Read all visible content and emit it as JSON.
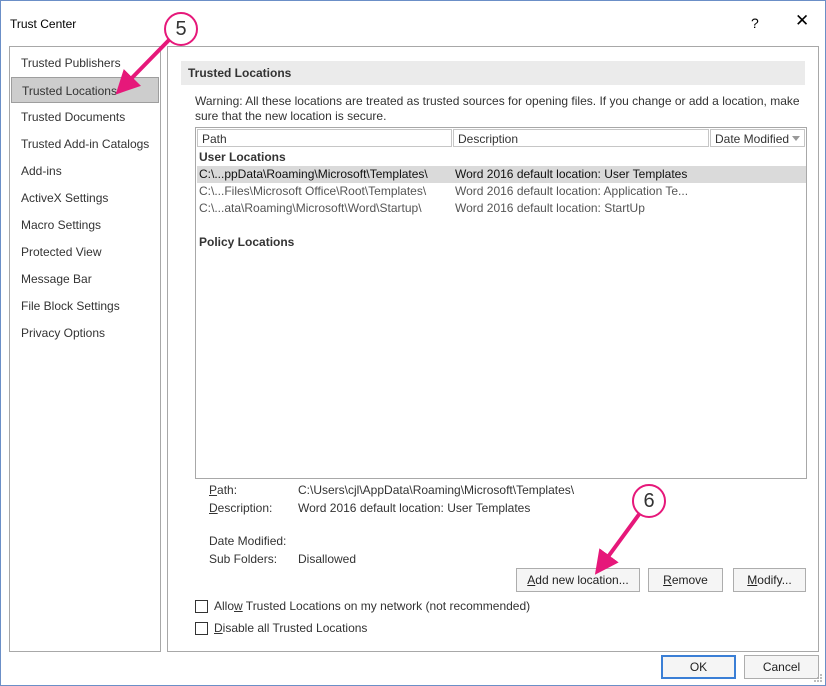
{
  "window": {
    "title": "Trust Center",
    "help_glyph": "?",
    "close_glyph": "✕"
  },
  "sidebar": {
    "items": [
      {
        "label": "Trusted Publishers"
      },
      {
        "label": "Trusted Locations",
        "selected": true
      },
      {
        "label": "Trusted Documents"
      },
      {
        "label": "Trusted Add-in Catalogs"
      },
      {
        "label": "Add-ins"
      },
      {
        "label": "ActiveX Settings"
      },
      {
        "label": "Macro Settings"
      },
      {
        "label": "Protected View"
      },
      {
        "label": "Message Bar"
      },
      {
        "label": "File Block Settings"
      },
      {
        "label": "Privacy Options"
      }
    ]
  },
  "main": {
    "section_title": "Trusted Locations",
    "warning": "Warning: All these locations are treated as trusted sources for opening files.  If you change or add a location, make sure that the new location is secure.",
    "columns": [
      "Path",
      "Description",
      "Date Modified"
    ],
    "user_locations_label": "User Locations",
    "rows": [
      {
        "path": "C:\\...ppData\\Roaming\\Microsoft\\Templates\\",
        "description": "Word 2016 default location: User Templates",
        "selected": true
      },
      {
        "path": "C:\\...Files\\Microsoft Office\\Root\\Templates\\",
        "description": "Word 2016 default location: Application Te..."
      },
      {
        "path": "C:\\...ata\\Roaming\\Microsoft\\Word\\Startup\\",
        "description": "Word 2016 default location: StartUp"
      }
    ],
    "policy_locations_label": "Policy Locations",
    "details": {
      "path_label": "Path:",
      "path_value": "C:\\Users\\cjl\\AppData\\Roaming\\Microsoft\\Templates\\",
      "description_label": "Description:",
      "description_value": "Word 2016 default location: User Templates",
      "date_modified_label": "Date Modified:",
      "date_modified_value": "",
      "sub_folders_label": "Sub Folders:",
      "sub_folders_value": "Disallowed"
    },
    "buttons": {
      "add": "Add new location...",
      "remove": "Remove",
      "modify": "Modify..."
    },
    "checkboxes": {
      "allow_network": {
        "label": "Allow Trusted Locations on my network (not recommended)",
        "checked": false
      },
      "disable_all": {
        "label": "Disable all Trusted Locations",
        "checked": false
      }
    }
  },
  "footer": {
    "ok": "OK",
    "cancel": "Cancel"
  },
  "annotations": {
    "step5": "5",
    "step6": "6",
    "color": "#e6187a"
  }
}
